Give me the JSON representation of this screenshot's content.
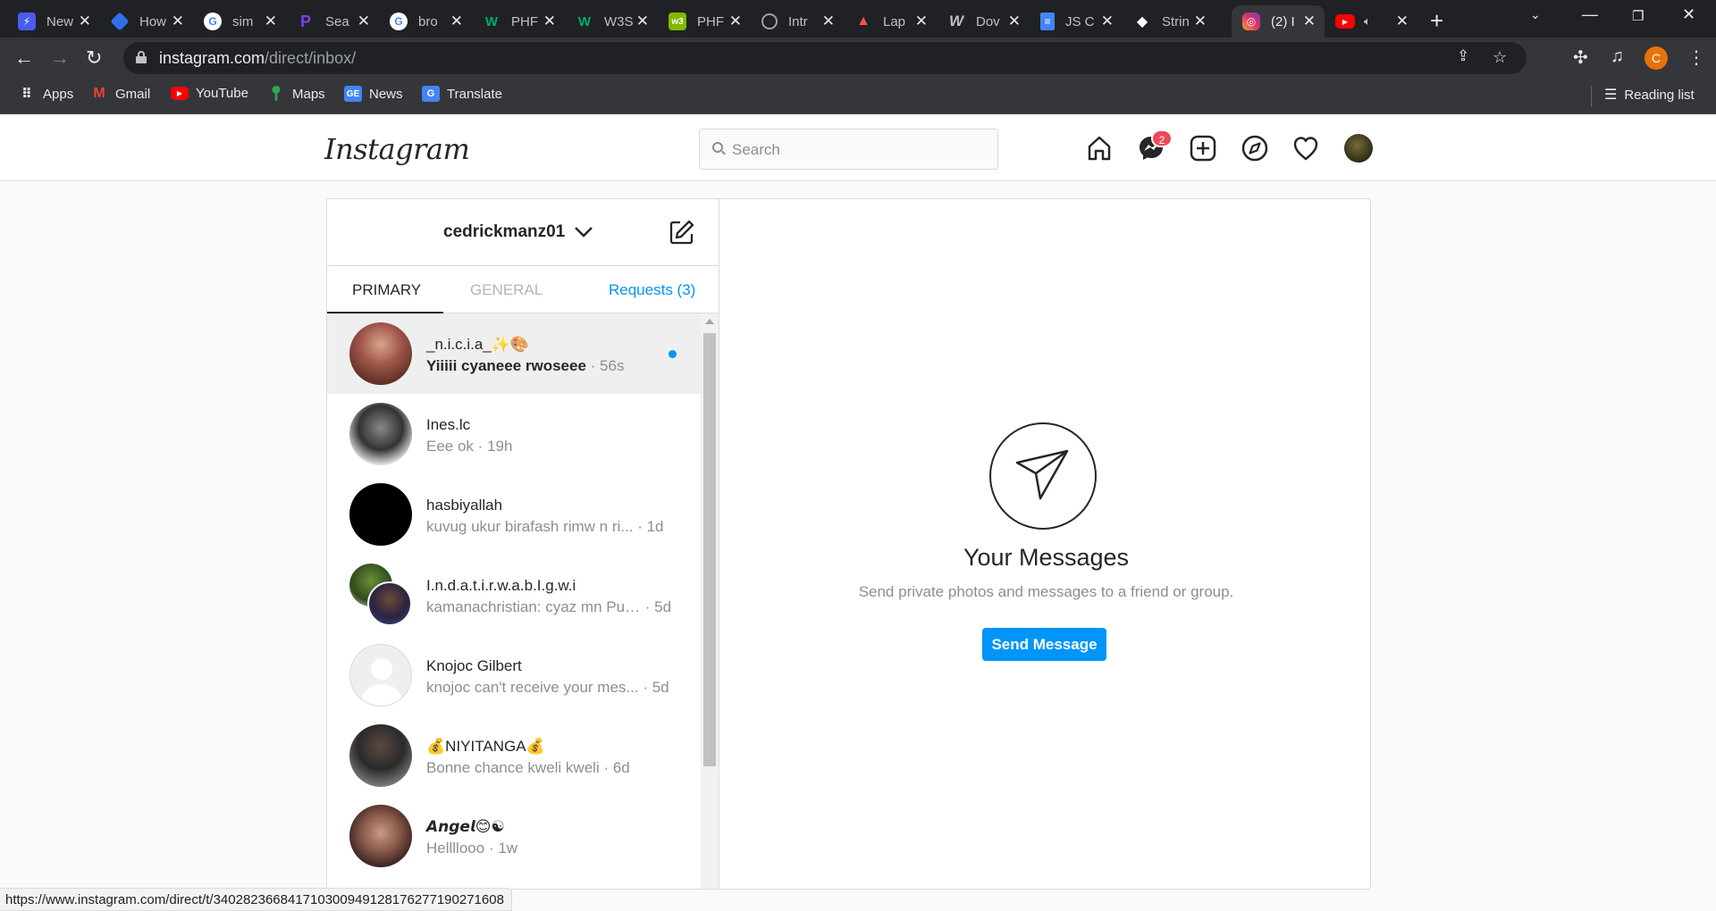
{
  "browser": {
    "tabs": [
      {
        "title": "New",
        "icon": "messenger-icon",
        "color": "#4a5cf0"
      },
      {
        "title": "How",
        "icon": "diamond-icon",
        "color": "#2f6fee"
      },
      {
        "title": "sim",
        "icon": "google-icon",
        "color": "#4285f4"
      },
      {
        "title": "Sea",
        "icon": "p-logo-icon",
        "color": "#7b3ff2"
      },
      {
        "title": "bro",
        "icon": "google-icon",
        "color": "#4285f4"
      },
      {
        "title": "PHF",
        "icon": "w3-icon",
        "color": "#04aa6d"
      },
      {
        "title": "W3S",
        "icon": "w3-icon",
        "color": "#04aa6d"
      },
      {
        "title": "PHF",
        "icon": "php-green-icon",
        "color": "#7fba00"
      },
      {
        "title": "Intr",
        "icon": "globe-icon",
        "color": "#9aa0a6"
      },
      {
        "title": "Lap",
        "icon": "laravel-icon",
        "color": "#f55247"
      },
      {
        "title": "Dov",
        "icon": "w-logo-icon",
        "color": "#9aa0a6"
      },
      {
        "title": "JS C",
        "icon": "docs-icon",
        "color": "#4285f4"
      },
      {
        "title": "Strin",
        "icon": "cap-icon",
        "color": "#ffffff"
      },
      {
        "title": "(2) I",
        "icon": "instagram-icon",
        "color": "#c13584",
        "active": true
      },
      {
        "title": "",
        "icon": "youtube-icon",
        "color": "#ff0000"
      }
    ],
    "url_domain": "instagram.com",
    "url_path": "/direct/inbox/",
    "profile_initial": "C",
    "bookmarks": [
      {
        "label": "Apps",
        "icon": "apps-grid-icon"
      },
      {
        "label": "Gmail",
        "icon": "gmail-icon"
      },
      {
        "label": "YouTube",
        "icon": "youtube-icon"
      },
      {
        "label": "Maps",
        "icon": "maps-icon"
      },
      {
        "label": "News",
        "icon": "news-icon"
      },
      {
        "label": "Translate",
        "icon": "translate-icon"
      }
    ],
    "reading_list": "Reading list",
    "status_url": "https://www.instagram.com/direct/t/340282366841710300949128176277190271608"
  },
  "instagram": {
    "logo": "Instagram",
    "search_placeholder": "Search",
    "dm_badge": "2",
    "username": "cedrickmanz01",
    "tabs": {
      "primary": "PRIMARY",
      "general": "GENERAL",
      "requests": "Requests (3)"
    },
    "threads": [
      {
        "name": "_n.i.c.i.a_✨🎨",
        "message": "Yiiiii cyaneee rwoseee",
        "time": "· 56s",
        "unread": true
      },
      {
        "name": "Ines.lc",
        "message": "Eee ok",
        "time": "· 19h",
        "unread": false
      },
      {
        "name": "hasbiyallah",
        "message": "kuvug ukur birafash rimw n ri...",
        "time": "· 1d",
        "unread": false
      },
      {
        "name": "I.n.d.a.t.i.r.w.a.b.I.g.w.i",
        "message": "kamanachristian: cyaz mn Pur...",
        "time": "· 5d",
        "unread": false
      },
      {
        "name": "Knojoc Gilbert",
        "message": "knojoc can't receive your mes...",
        "time": "· 5d",
        "unread": false
      },
      {
        "name": "💰NIYITANGA💰",
        "message": "Bonne chance kweli kweli",
        "time": "· 6d",
        "unread": false
      },
      {
        "name": "𝘼𝙣𝙜𝙚𝙡😊☯",
        "message": "Hellllooo",
        "time": "· 1w",
        "unread": false
      }
    ],
    "empty_state": {
      "title": "Your Messages",
      "subtitle": "Send private photos and messages to a friend or group.",
      "button": "Send Message"
    },
    "colors": {
      "accent": "#0095f6",
      "badge": "#ed4956",
      "text": "#262626",
      "muted": "#8e8e8e"
    }
  }
}
